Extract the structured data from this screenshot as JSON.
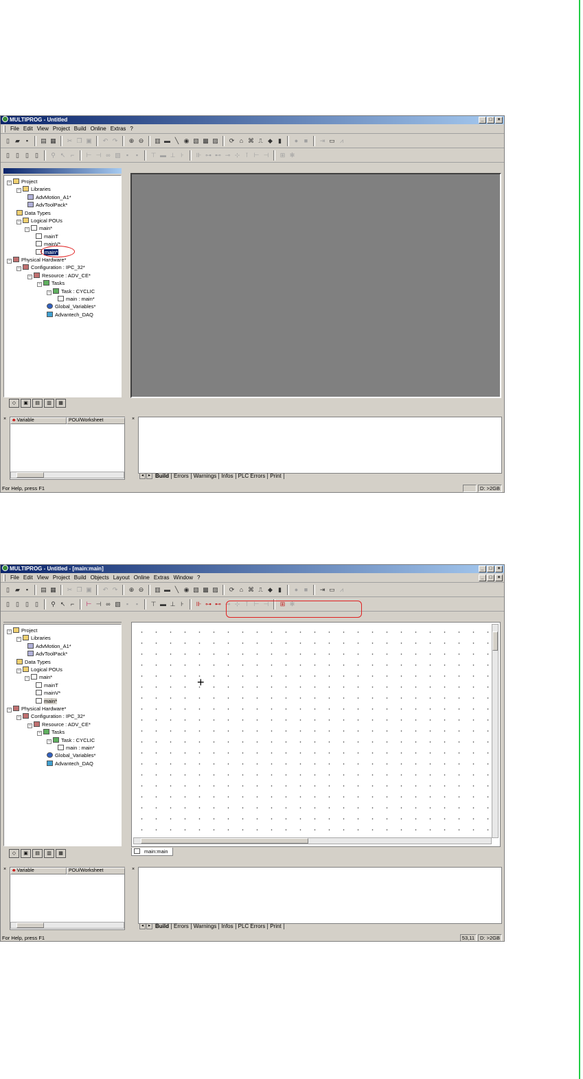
{
  "window1": {
    "title": "MULTIPROG - Untitled",
    "menu": [
      "File",
      "Edit",
      "View",
      "Project",
      "Build",
      "Online",
      "Extras",
      "?"
    ],
    "tree": [
      {
        "label": "Project",
        "icon": "folder-icon"
      },
      {
        "label": "Libraries",
        "icon": "folder-icon"
      },
      {
        "label": "AdvMotion_A1*",
        "icon": "library-icon"
      },
      {
        "label": "AdvToolPack*",
        "icon": "library-icon"
      },
      {
        "label": "Data Types",
        "icon": "folder-icon"
      },
      {
        "label": "Logical POUs",
        "icon": "folder-icon"
      },
      {
        "label": "main*",
        "icon": "pou-icon"
      },
      {
        "label": "mainT",
        "icon": "pou-icon"
      },
      {
        "label": "mainV*",
        "icon": "pou-icon"
      },
      {
        "label": "main*",
        "icon": "pou-icon"
      },
      {
        "label": "Physical Hardware*",
        "icon": "hardware-icon"
      },
      {
        "label": "Configuration : IPC_32*",
        "icon": "hardware-icon"
      },
      {
        "label": "Resource : ADV_CE*",
        "icon": "hardware-icon"
      },
      {
        "label": "Tasks",
        "icon": "task-icon"
      },
      {
        "label": "Task : CYCLIC",
        "icon": "task-icon"
      },
      {
        "label": "main : main*",
        "icon": "pou-icon"
      },
      {
        "label": "Global_Variables*",
        "icon": "globe-icon"
      },
      {
        "label": "Advantech_DAQ",
        "icon": "daq-icon"
      }
    ],
    "var_columns": [
      "Variable",
      "POU/Worksheet"
    ],
    "output_tabs": [
      "Build",
      "Errors",
      "Warnings",
      "Infos",
      "PLC Errors",
      "Print"
    ],
    "status_left": "For Help, press F1",
    "status_right": [
      "",
      "D: >2GB"
    ]
  },
  "window2": {
    "title": "MULTIPROG - Untitled - [main:main]",
    "menu": [
      "File",
      "Edit",
      "View",
      "Project",
      "Build",
      "Objects",
      "Layout",
      "Online",
      "Extras",
      "Window",
      "?"
    ],
    "tree": [
      {
        "label": "Project",
        "icon": "folder-icon"
      },
      {
        "label": "Libraries",
        "icon": "folder-icon"
      },
      {
        "label": "AdvMotion_A1*",
        "icon": "library-icon"
      },
      {
        "label": "AdvToolPack*",
        "icon": "library-icon"
      },
      {
        "label": "Data Types",
        "icon": "folder-icon"
      },
      {
        "label": "Logical POUs",
        "icon": "folder-icon"
      },
      {
        "label": "main*",
        "icon": "pou-icon"
      },
      {
        "label": "mainT",
        "icon": "pou-icon"
      },
      {
        "label": "mainV*",
        "icon": "pou-icon"
      },
      {
        "label": "main*",
        "icon": "pou-icon"
      },
      {
        "label": "Physical Hardware*",
        "icon": "hardware-icon"
      },
      {
        "label": "Configuration : IPC_32*",
        "icon": "hardware-icon"
      },
      {
        "label": "Resource : ADV_CE*",
        "icon": "hardware-icon"
      },
      {
        "label": "Tasks",
        "icon": "task-icon"
      },
      {
        "label": "Task : CYCLIC",
        "icon": "task-icon"
      },
      {
        "label": "main : main*",
        "icon": "pou-icon"
      },
      {
        "label": "Global_Variables*",
        "icon": "globe-icon"
      },
      {
        "label": "Advantech_DAQ",
        "icon": "daq-icon"
      }
    ],
    "editor_tab": "main:main",
    "var_columns": [
      "Variable",
      "POU/Worksheet"
    ],
    "output_tabs": [
      "Build",
      "Errors",
      "Warnings",
      "Infos",
      "PLC Errors",
      "Print"
    ],
    "status_left": "For Help, press F1",
    "status_right": [
      "53,11",
      "D: >2GB"
    ]
  },
  "colors": {
    "highlight": "#e02020",
    "title_bar": "#0a246a",
    "margin_line": "#22cc44"
  }
}
